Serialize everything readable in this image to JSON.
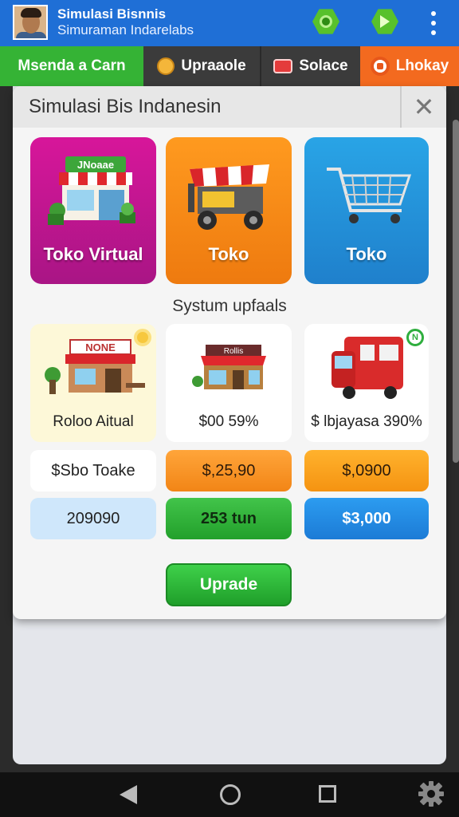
{
  "header": {
    "title": "Simulasi Bisnnis",
    "subtitle": "Simuraman Indarelabs"
  },
  "tabs": [
    {
      "label": "Msenda a Carn"
    },
    {
      "label": "Upraaole"
    },
    {
      "label": "Solace"
    },
    {
      "label": "Lhokay"
    }
  ],
  "dialog": {
    "title": "Simulasi Bis Indanesin",
    "close_glyph": "✕",
    "cards": [
      {
        "label": "Toko Virtual",
        "sign": "JNoaae"
      },
      {
        "label": "Toko"
      },
      {
        "label": "Toko"
      }
    ],
    "section_label": "Systum upfaals",
    "upgrades": [
      {
        "label": "Roloo Aitual",
        "sign": "NONE",
        "badge": ""
      },
      {
        "label": "$00 59%",
        "sign": "Rollis",
        "badge": ""
      },
      {
        "label": "$ lbjayasa 390%",
        "badge": "N"
      }
    ],
    "prices_row1": [
      "$Sbo Toake",
      "$,25,90",
      "$,0900"
    ],
    "prices_row2": [
      "209090",
      "253 tun",
      "$3,000"
    ],
    "upgrade_button": "Uprade"
  },
  "colors": {
    "appbar": "#1f6fd6",
    "tab_active": "#35b335",
    "tab_orange": "#f36a1f",
    "card_pink": "#c8168f",
    "card_orange": "#f58a18",
    "card_blue": "#2592da",
    "upgrade_green": "#2bb537"
  },
  "icons": [
    "avatar",
    "hex-settings-icon",
    "hex-arrow-icon",
    "more-vert-icon",
    "smiley-icon",
    "tv-icon",
    "clock-icon",
    "shop-icon",
    "cart-icon",
    "truck-icon",
    "back-icon",
    "home-icon",
    "recents-icon",
    "gear-icon"
  ]
}
